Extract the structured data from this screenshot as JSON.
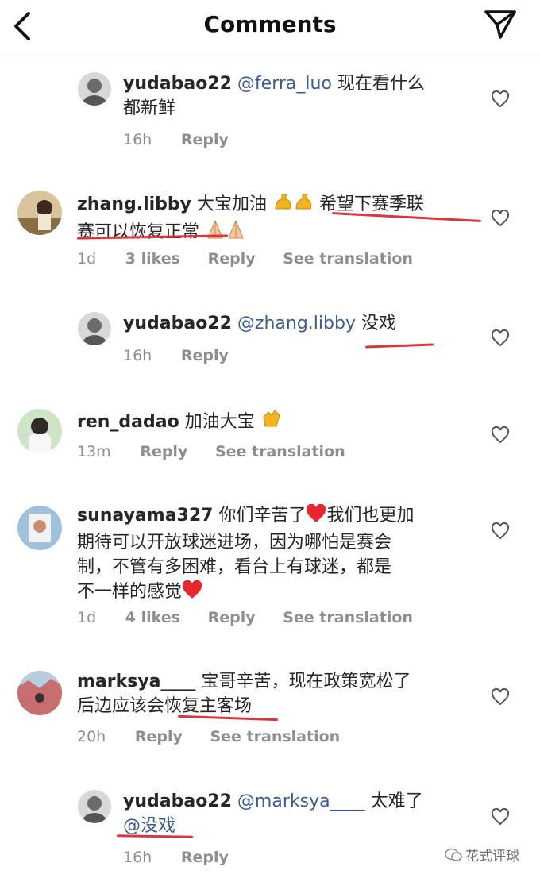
{
  "header": {
    "title": "Comments"
  },
  "comments": [
    {
      "username": "yudabao22",
      "mention": "@ferra_luo",
      "text1": "现在看什么",
      "text2": "都新鲜",
      "time": "16h",
      "reply": "Reply"
    },
    {
      "username": "zhang.libby",
      "text1a": "大宝加油",
      "text1b": "希望下赛季联",
      "text2": "赛可以恢复正常",
      "time": "1d",
      "likes": "3 likes",
      "reply": "Reply",
      "translate": "See translation"
    },
    {
      "username": "yudabao22",
      "mention": "@zhang.libby",
      "text1": "没戏",
      "time": "16h",
      "reply": "Reply"
    },
    {
      "username": "ren_dadao",
      "text1": "加油大宝",
      "time": "13m",
      "reply": "Reply",
      "translate": "See translation"
    },
    {
      "username": "sunayama327",
      "text1": "你们辛苦了",
      "text1b": "我们也更加",
      "text2": "期待可以开放球迷进场，因为哪怕是赛会",
      "text3": "制，不管有多困难，看台上有球迷，都是",
      "text4": "不一样的感觉",
      "time": "1d",
      "likes": "4 likes",
      "reply": "Reply",
      "translate": "See translation"
    },
    {
      "username": "marksya____",
      "text1": "宝哥辛苦，现在政策宽松了",
      "text2": "后边应该会恢复主客场",
      "time": "20h",
      "reply": "Reply",
      "translate": "See translation"
    },
    {
      "username": "yudabao22",
      "mention": "@marksya____",
      "text1": "太难了",
      "text2": "@没戏",
      "time": "16h",
      "reply": "Reply"
    }
  ],
  "watermark": "花式评球",
  "colors": {
    "mention": "#3a5b93",
    "meta": "#8e8e8e",
    "underline": "#d9363e"
  }
}
